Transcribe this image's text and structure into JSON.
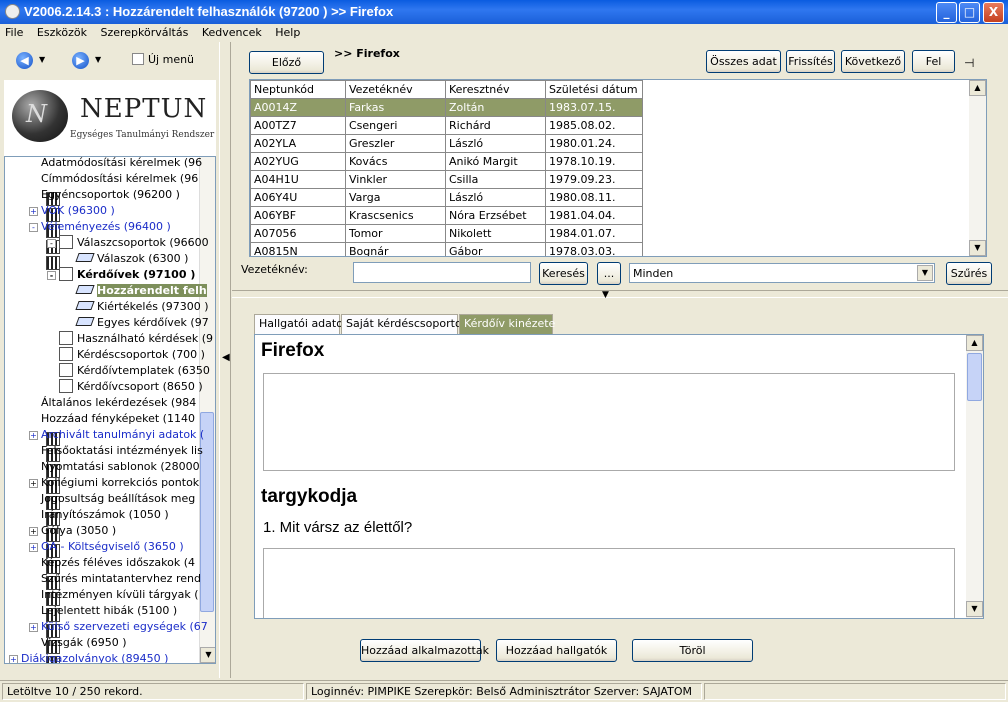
{
  "window": {
    "title": "V2006.2.14.3 : Hozzárendelt felhasználók (97200  )  >> Firefox",
    "minimize": "_",
    "maximize": "□",
    "close": "X"
  },
  "menu": [
    "File",
    "Eszközök",
    "Szerepkörváltás",
    "Kedvencek",
    "Help"
  ],
  "nav": {
    "back_icon": "back-arrow-icon",
    "forward_icon": "forward-arrow-icon",
    "uj_menu_label": "Új menü"
  },
  "logo": {
    "name": "NEPTUN",
    "subtitle": "Egységes Tanulmányi Rendszer"
  },
  "tree": [
    {
      "label": "Adatmódosítási kérelmek (96",
      "indent": 0,
      "icon": "grid",
      "exp": ""
    },
    {
      "label": "Címmódosítási kérelmek (96",
      "indent": 0,
      "icon": "grid",
      "exp": ""
    },
    {
      "label": "Egyéncsoportok (96200  )",
      "indent": 0,
      "icon": "grid",
      "exp": ""
    },
    {
      "label": "VOK (96300  )",
      "indent": 0,
      "icon": "grid",
      "exp": "+",
      "style": "blue"
    },
    {
      "label": "Véleményezés (96400  )",
      "indent": 0,
      "icon": "grid",
      "exp": "-",
      "style": "blue"
    },
    {
      "label": "Válaszcsoportok (96600",
      "indent": 1,
      "icon": "doc",
      "exp": "-"
    },
    {
      "label": "Válaszok (6300  )",
      "indent": 2,
      "icon": "form",
      "exp": ""
    },
    {
      "label": "Kérdőívek (97100  )",
      "indent": 1,
      "icon": "doc",
      "exp": "-",
      "style": "bold"
    },
    {
      "label": "Hozzárendelt felh",
      "indent": 2,
      "icon": "form",
      "exp": "",
      "style": "sel"
    },
    {
      "label": "Kiértékelés (97300  )",
      "indent": 2,
      "icon": "form",
      "exp": ""
    },
    {
      "label": "Egyes kérdőívek (97",
      "indent": 2,
      "icon": "form",
      "exp": ""
    },
    {
      "label": "Használható kérdések (9",
      "indent": 1,
      "icon": "doc",
      "exp": ""
    },
    {
      "label": "Kérdéscsoportok (700  )",
      "indent": 1,
      "icon": "doc",
      "exp": ""
    },
    {
      "label": "Kérdőívtemplatek (6350",
      "indent": 1,
      "icon": "doc",
      "exp": ""
    },
    {
      "label": "Kérdőívcsoport (8650  )",
      "indent": 1,
      "icon": "doc",
      "exp": ""
    },
    {
      "label": "Általános lekérdezések (984",
      "indent": 0,
      "icon": "grid",
      "exp": ""
    },
    {
      "label": "Hozzáad fényképeket (1140",
      "indent": 0,
      "icon": "grid",
      "exp": ""
    },
    {
      "label": "Archivált tanulmányi adatok (",
      "indent": 0,
      "icon": "grid",
      "exp": "+",
      "style": "blue"
    },
    {
      "label": "Felsőoktatási intézmények lis",
      "indent": 0,
      "icon": "grid",
      "exp": ""
    },
    {
      "label": "Nyomtatási sablonok (28000",
      "indent": 0,
      "icon": "grid",
      "exp": ""
    },
    {
      "label": "Kollégiumi korrekciós pontok",
      "indent": 0,
      "icon": "grid",
      "exp": "+"
    },
    {
      "label": "Jogosultság beállítások meg",
      "indent": 0,
      "icon": "grid",
      "exp": ""
    },
    {
      "label": "Irányítószámok (1050  )",
      "indent": 0,
      "icon": "grid",
      "exp": ""
    },
    {
      "label": "Gólya (3050  )",
      "indent": 0,
      "icon": "grid",
      "exp": "+"
    },
    {
      "label": "OA - Költségviselő (3650  )",
      "indent": 0,
      "icon": "grid",
      "exp": "+",
      "style": "blue"
    },
    {
      "label": "Képzés féléves időszakok (4",
      "indent": 0,
      "icon": "grid",
      "exp": ""
    },
    {
      "label": "Szűrés mintatantervhez rend",
      "indent": 0,
      "icon": "grid",
      "exp": ""
    },
    {
      "label": "Intézményen kívüli tárgyak (",
      "indent": 0,
      "icon": "grid",
      "exp": ""
    },
    {
      "label": "Lejelentett hibák (5100  )",
      "indent": 0,
      "icon": "grid",
      "exp": ""
    },
    {
      "label": "Külső szervezeti egységek (67",
      "indent": 0,
      "icon": "grid",
      "exp": "+",
      "style": "blue"
    },
    {
      "label": "Vizsgák (6950  )",
      "indent": 0,
      "icon": "grid",
      "exp": ""
    },
    {
      "label": "Diákigazolványok (89450  )",
      "indent": -1,
      "icon": "grid",
      "exp": "+",
      "style": "blue"
    }
  ],
  "toolbar": {
    "elozo": "Előző",
    "crumb": ">> Firefox",
    "osszes_adat": "Összes adat",
    "frissites": "Frissítés",
    "kovetkezo": "Következő",
    "fel": "Fel",
    "pin_icon": "pin-icon"
  },
  "grid": {
    "columns": [
      "Neptunkód",
      "Vezetéknév",
      "Keresztnév",
      "Születési dátum"
    ],
    "rows": [
      [
        "A0014Z",
        "Farkas",
        "Zoltán",
        "1983.07.15."
      ],
      [
        "A00TZ7",
        "Csengeri",
        "Richárd",
        "1985.08.02."
      ],
      [
        "A02YLA",
        "Greszler",
        "László",
        "1980.01.24."
      ],
      [
        "A02YUG",
        "Kovács",
        "Anikó Margit",
        "1978.10.19."
      ],
      [
        "A04H1U",
        "Vinkler",
        "Csilla",
        "1979.09.23."
      ],
      [
        "A06Y4U",
        "Varga",
        "László",
        "1980.08.11."
      ],
      [
        "A06YBF",
        "Krascsenics",
        "Nóra Erzsébet",
        "1981.04.04."
      ],
      [
        "A07056",
        "Tomor",
        "Nikolett",
        "1984.01.07."
      ],
      [
        "A0815N",
        "Bognár",
        "Gábor",
        "1978.03.03."
      ]
    ],
    "selected_row": 0
  },
  "search": {
    "label": "Vezetéknév:",
    "value": "",
    "kereses": "Keresés",
    "dots": "...",
    "filter_value": "Minden",
    "szures": "Szűrés"
  },
  "tabs": [
    "Hallgatói adatok",
    "Saját kérdéscsoportok",
    "Kérdőív kinézete"
  ],
  "active_tab": 2,
  "panel": {
    "title": "Firefox",
    "section": "targykodja",
    "question": "1. Mit vársz az élettől?"
  },
  "bottom_buttons": {
    "hozzaad_alkalmazottak": "Hozzáad alkalmazottak",
    "hozzaad_hallgatok": "Hozzáad hallgatók",
    "torol": "Töröl"
  },
  "status": {
    "loaded": "Letöltve 10 / 250 rekord.",
    "user": "Loginnév: PIMPIKE   Szerepkör: Belső Adminisztrátor   Szerver: SAJATOM"
  }
}
